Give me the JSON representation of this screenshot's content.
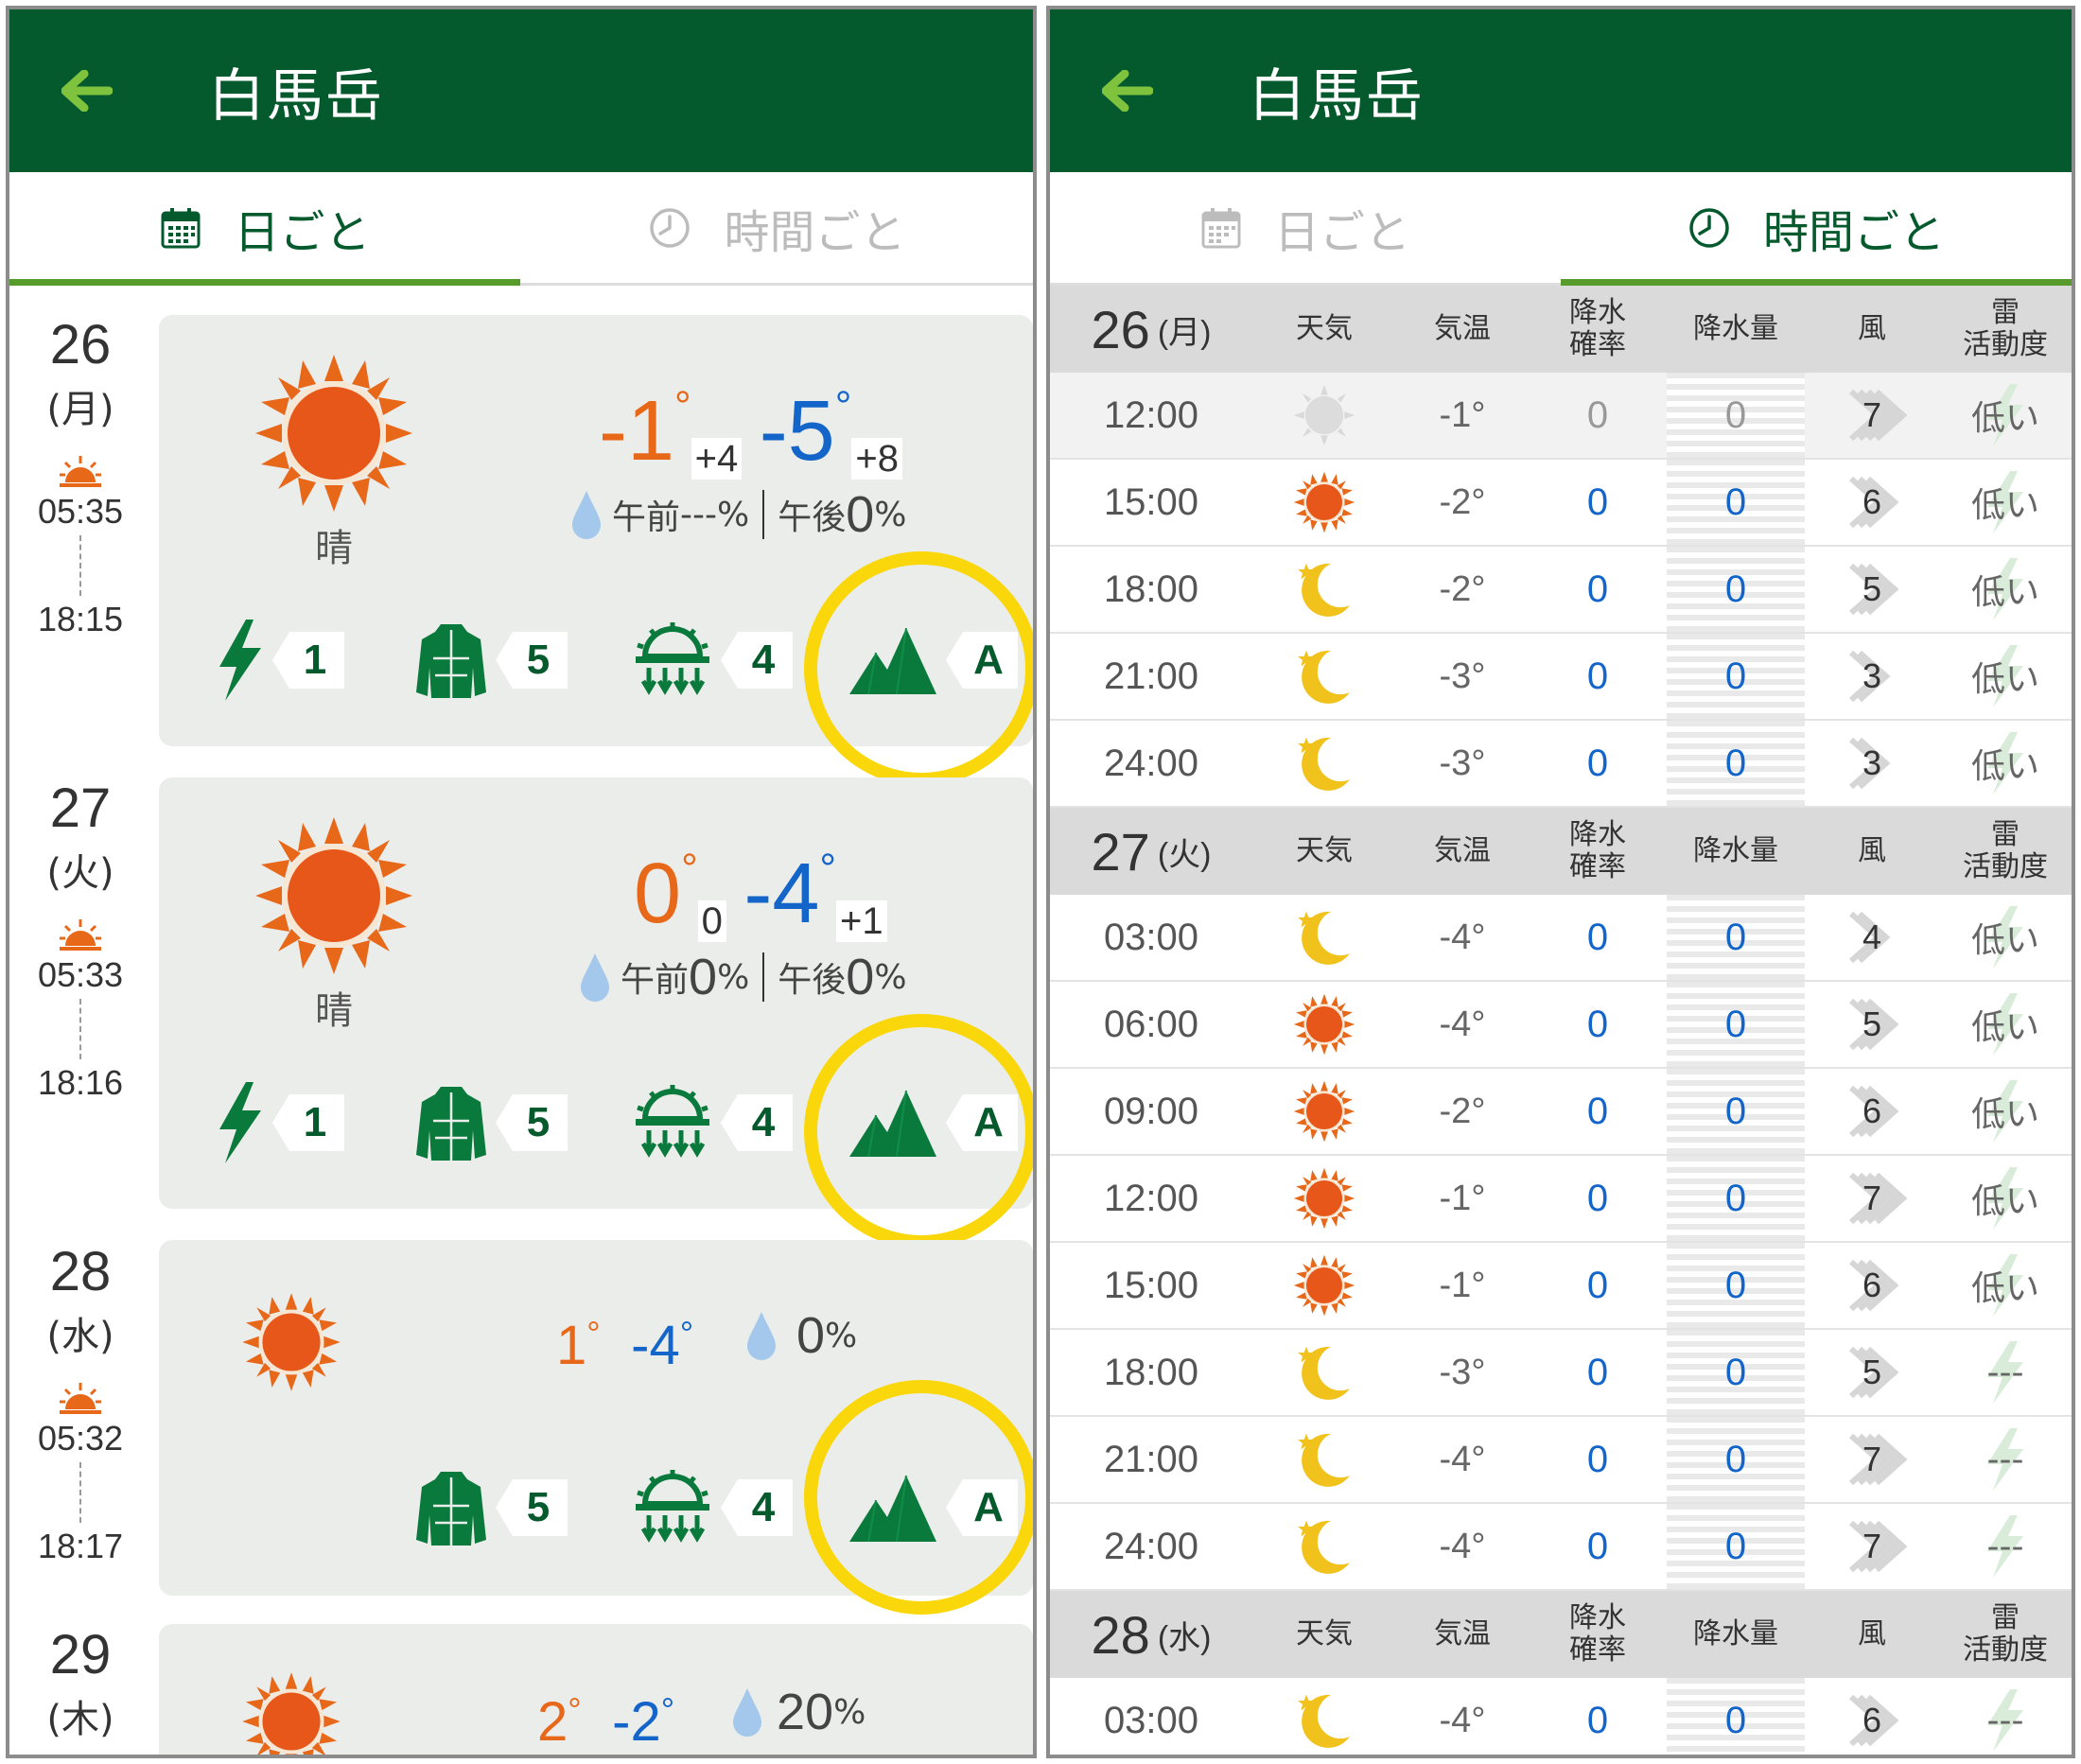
{
  "left": {
    "title": "白馬岳",
    "tabs": [
      {
        "label": "日ごと",
        "icon": "calendar-icon",
        "active": true
      },
      {
        "label": "時間ごと",
        "icon": "clock-icon",
        "active": false
      }
    ],
    "days": [
      {
        "date": "26",
        "weekday": "(月)",
        "sunrise": "05:35",
        "sunset": "18:15",
        "weather": "晴",
        "high": "-1",
        "high_diff": "+4",
        "low": "-5",
        "low_diff": "+8",
        "rain_am_label": "午前",
        "rain_am": "---",
        "rain_pm_label": "午後",
        "rain_pm": "0",
        "lightning": "1",
        "clothing": "5",
        "frost": "4",
        "climb": "A"
      },
      {
        "date": "27",
        "weekday": "(火)",
        "sunrise": "05:33",
        "sunset": "18:16",
        "weather": "晴",
        "high": "0",
        "high_diff": "0",
        "low": "-4",
        "low_diff": "+1",
        "rain_am_label": "午前",
        "rain_am": "0",
        "rain_pm_label": "午後",
        "rain_pm": "0",
        "lightning": "1",
        "clothing": "5",
        "frost": "4",
        "climb": "A"
      },
      {
        "date": "28",
        "weekday": "(水)",
        "sunrise": "05:32",
        "sunset": "18:17",
        "high": "1",
        "low": "-4",
        "rain": "0",
        "clothing": "5",
        "frost": "4",
        "climb": "A"
      },
      {
        "date": "29",
        "weekday": "(木)",
        "high": "2",
        "low": "-2",
        "rain": "20"
      }
    ],
    "deg": "°",
    "pct": "%"
  },
  "right": {
    "title": "白馬岳",
    "tabs": [
      {
        "label": "日ごと",
        "icon": "calendar-icon",
        "active": false
      },
      {
        "label": "時間ごと",
        "icon": "clock-icon",
        "active": true
      }
    ],
    "columns": [
      "天気",
      "気温",
      "降水\n確率",
      "降水量",
      "風",
      "雷\n活動度"
    ],
    "groups": [
      {
        "date": "26",
        "weekday": "(月)",
        "rows": [
          {
            "time": "12:00",
            "weather": "sun-gray",
            "temp": "-1°",
            "prob": "0",
            "amount": "0",
            "wind": "7",
            "thunder": "低い",
            "past": true
          },
          {
            "time": "15:00",
            "weather": "sun",
            "temp": "-2°",
            "prob": "0",
            "amount": "0",
            "wind": "6",
            "thunder": "低い"
          },
          {
            "time": "18:00",
            "weather": "moon",
            "temp": "-2°",
            "prob": "0",
            "amount": "0",
            "wind": "5",
            "thunder": "低い"
          },
          {
            "time": "21:00",
            "weather": "moon",
            "temp": "-3°",
            "prob": "0",
            "amount": "0",
            "wind": "3",
            "thunder": "低い"
          },
          {
            "time": "24:00",
            "weather": "moon",
            "temp": "-3°",
            "prob": "0",
            "amount": "0",
            "wind": "3",
            "thunder": "低い"
          }
        ]
      },
      {
        "date": "27",
        "weekday": "(火)",
        "rows": [
          {
            "time": "03:00",
            "weather": "moon",
            "temp": "-4°",
            "prob": "0",
            "amount": "0",
            "wind": "4",
            "thunder": "低い"
          },
          {
            "time": "06:00",
            "weather": "sun",
            "temp": "-4°",
            "prob": "0",
            "amount": "0",
            "wind": "5",
            "thunder": "低い"
          },
          {
            "time": "09:00",
            "weather": "sun",
            "temp": "-2°",
            "prob": "0",
            "amount": "0",
            "wind": "6",
            "thunder": "低い"
          },
          {
            "time": "12:00",
            "weather": "sun",
            "temp": "-1°",
            "prob": "0",
            "amount": "0",
            "wind": "7",
            "thunder": "低い"
          },
          {
            "time": "15:00",
            "weather": "sun",
            "temp": "-1°",
            "prob": "0",
            "amount": "0",
            "wind": "6",
            "thunder": "低い"
          },
          {
            "time": "18:00",
            "weather": "moon",
            "temp": "-3°",
            "prob": "0",
            "amount": "0",
            "wind": "5",
            "thunder": "---"
          },
          {
            "time": "21:00",
            "weather": "moon",
            "temp": "-4°",
            "prob": "0",
            "amount": "0",
            "wind": "7",
            "thunder": "---"
          },
          {
            "time": "24:00",
            "weather": "moon",
            "temp": "-4°",
            "prob": "0",
            "amount": "0",
            "wind": "7",
            "thunder": "---"
          }
        ]
      },
      {
        "date": "28",
        "weekday": "(水)",
        "rows": [
          {
            "time": "03:00",
            "weather": "moon",
            "temp": "-4°",
            "prob": "0",
            "amount": "0",
            "wind": "6",
            "thunder": "---"
          }
        ]
      }
    ]
  },
  "colors": {
    "header": "#045a2d",
    "accent_line": "#579b2b",
    "high": "#e8681a",
    "low": "#1465c9",
    "highlight": "#fad70a",
    "icon_green": "#0a7a3c"
  }
}
